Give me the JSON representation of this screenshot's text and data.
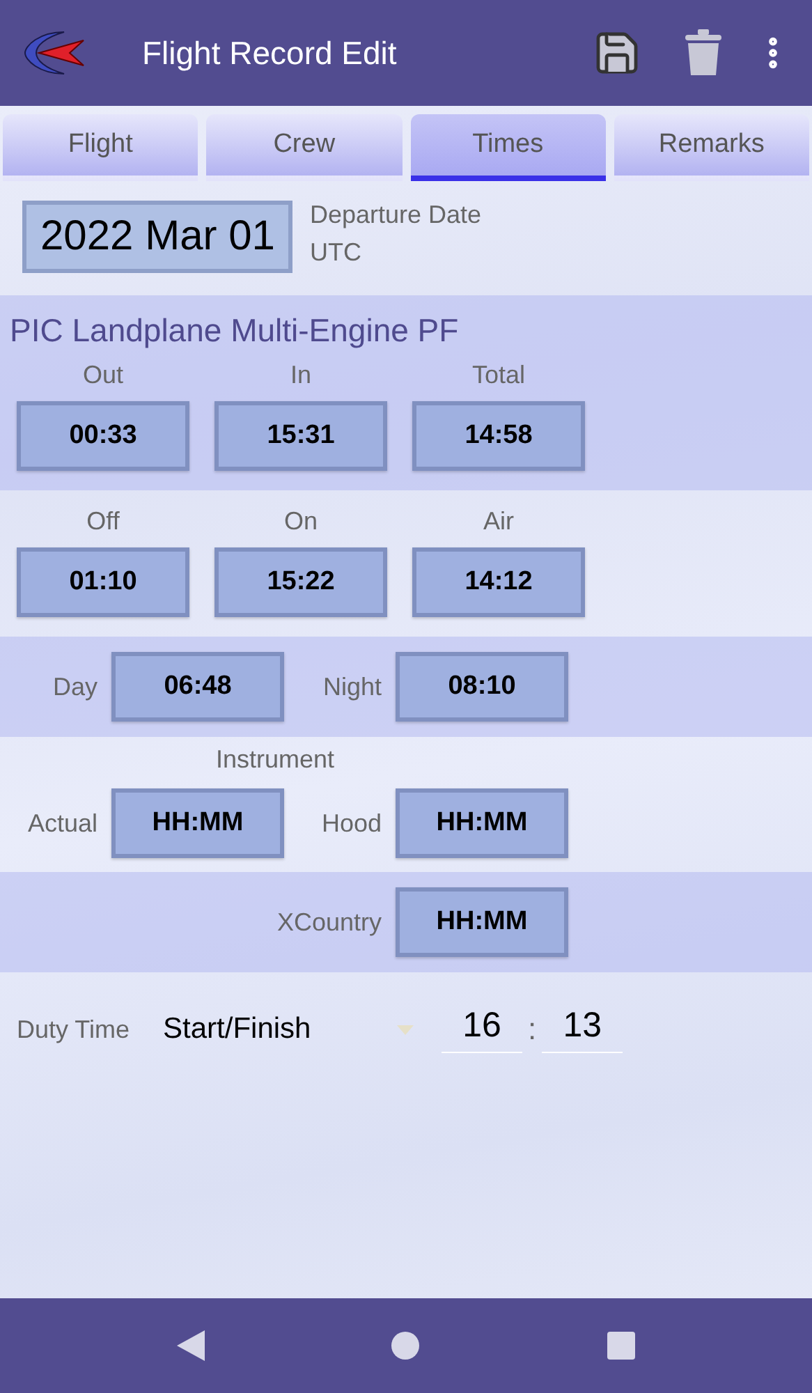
{
  "header": {
    "title": "Flight Record Edit"
  },
  "tabs": [
    {
      "label": "Flight",
      "selected": false
    },
    {
      "label": "Crew",
      "selected": false
    },
    {
      "label": "Times",
      "selected": true
    },
    {
      "label": "Remarks",
      "selected": false
    }
  ],
  "date": {
    "value": "2022 Mar 01",
    "label": "Departure Date",
    "sublabel": "UTC"
  },
  "category": "PIC Landplane Multi-Engine PF",
  "bands": [
    {
      "kind": "stacked",
      "tinted": true,
      "fields": [
        {
          "label": "Out",
          "value": "00:33"
        },
        {
          "label": "In",
          "value": "15:31"
        },
        {
          "label": "Total",
          "value": "14:58"
        }
      ]
    },
    {
      "kind": "stacked",
      "tinted": false,
      "fields": [
        {
          "label": "Off",
          "value": "01:10"
        },
        {
          "label": "On",
          "value": "15:22"
        },
        {
          "label": "Air",
          "value": "14:12"
        }
      ]
    },
    {
      "kind": "inline",
      "tinted": true,
      "fields": [
        {
          "label": "Day",
          "value": "06:48"
        },
        {
          "label": "Night",
          "value": "08:10"
        }
      ]
    },
    {
      "kind": "inline",
      "tinted": false,
      "heading": "Instrument",
      "fields": [
        {
          "label": "Actual",
          "value": "HH:MM"
        },
        {
          "label": "Hood",
          "value": "HH:MM"
        }
      ]
    },
    {
      "kind": "inline",
      "tinted": true,
      "fields": [
        {
          "label": "XCountry",
          "value": "HH:MM"
        }
      ]
    }
  ],
  "duty": {
    "label": "Duty Time",
    "mode": "Start/Finish",
    "hours": "16",
    "separator": ":",
    "minutes": "13"
  }
}
